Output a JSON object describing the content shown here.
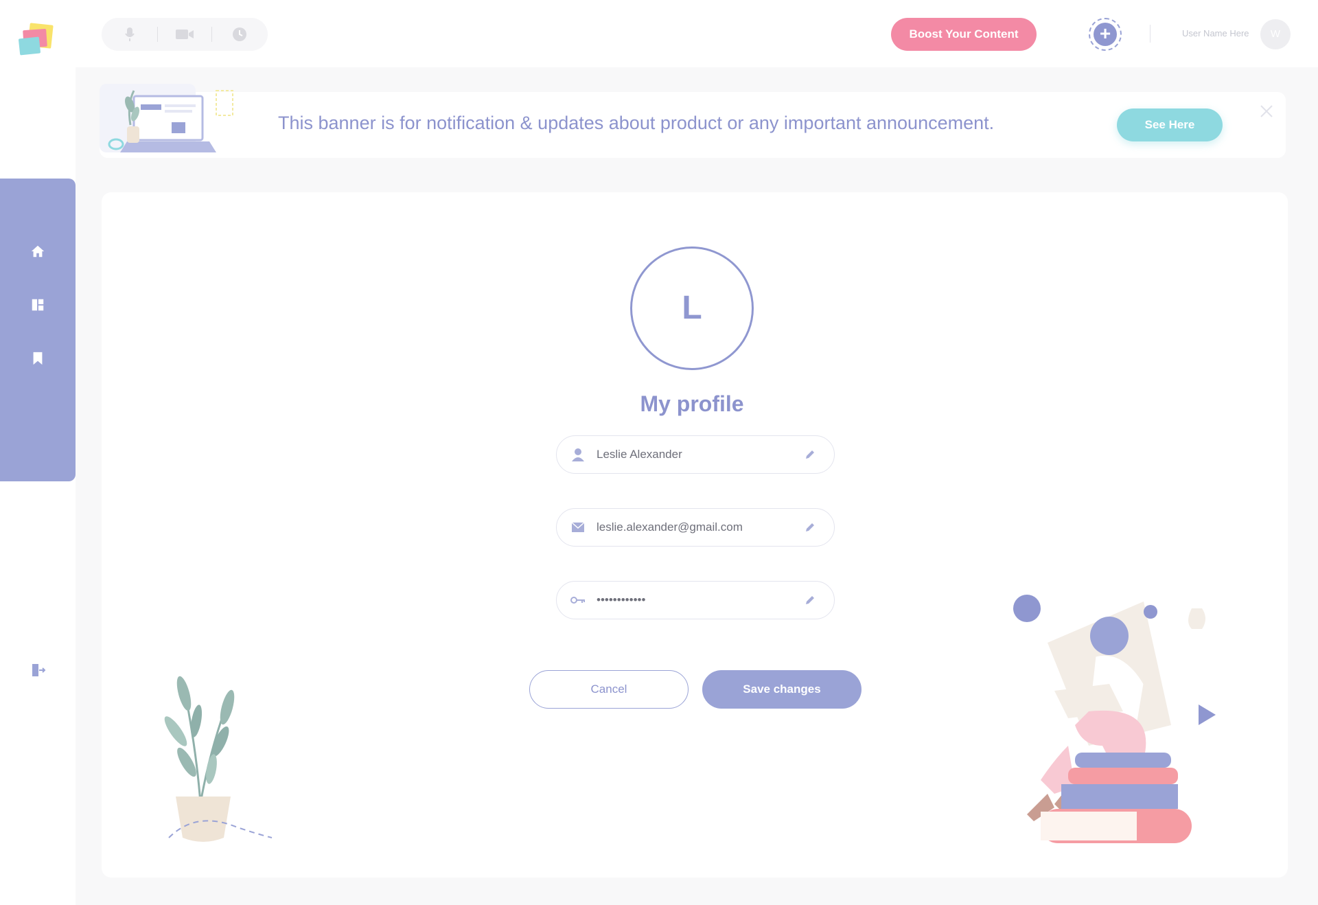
{
  "topbar": {
    "media_buttons": [
      "microphone-icon",
      "video-camera-icon",
      "clock-icon"
    ],
    "boost_label": "Boost Your Content",
    "user_name": "User Name Here",
    "user_initial": "W"
  },
  "sidebar": {
    "items": [
      {
        "name": "home",
        "icon": "home-icon"
      },
      {
        "name": "dashboard",
        "icon": "dashboard-icon"
      },
      {
        "name": "bookmarks",
        "icon": "bookmark-icon"
      }
    ],
    "logout_icon": "logout-icon"
  },
  "banner": {
    "text": "This banner is for notification & updates about product or any important announcement.",
    "button_label": "See Here"
  },
  "profile": {
    "initial": "L",
    "title": "My profile",
    "name": "Leslie Alexander",
    "email": "leslie.alexander@gmail.com",
    "password": "••••••••••••",
    "cancel_label": "Cancel",
    "save_label": "Save changes"
  },
  "colors": {
    "accent": "#9aa3d6",
    "boost": "#f38aa5",
    "banner_button": "#8ed9e0",
    "background": "#f8f8f9"
  }
}
